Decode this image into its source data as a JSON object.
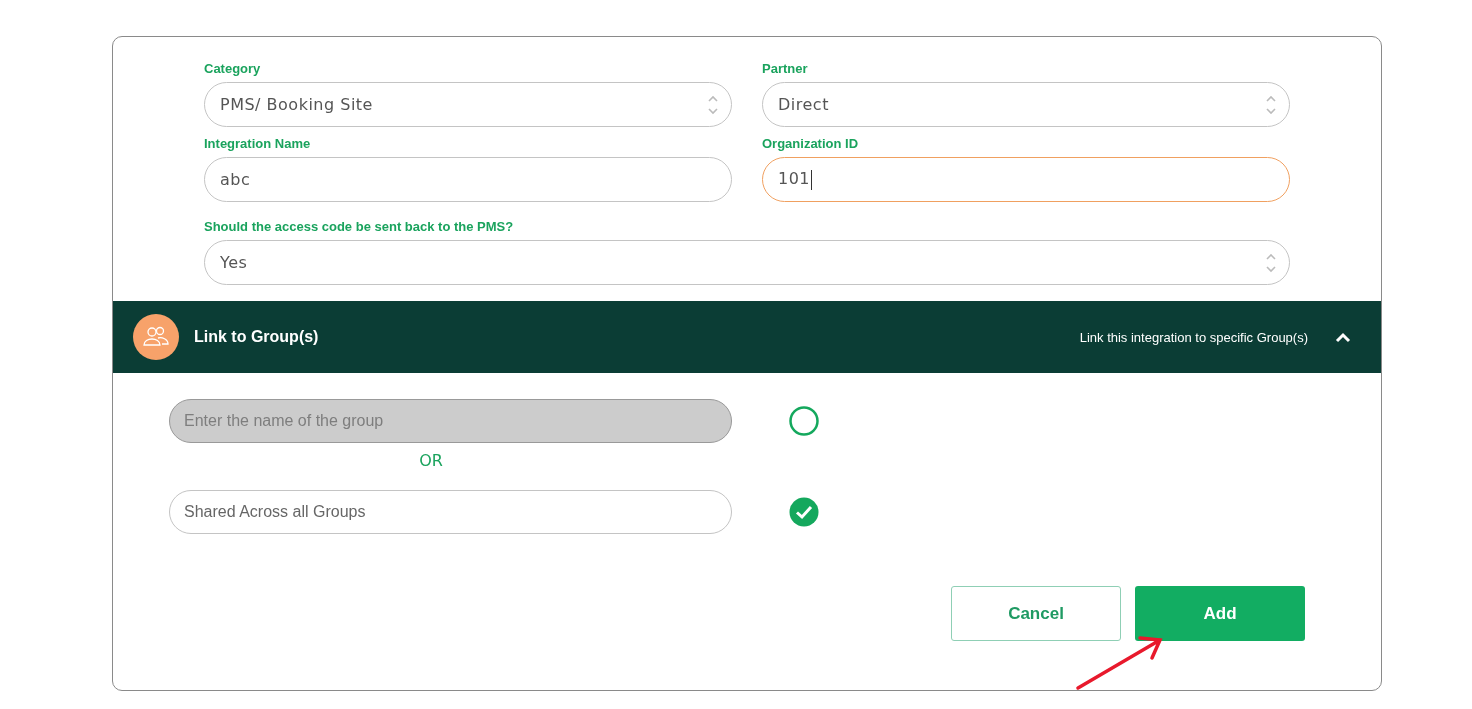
{
  "fields": [
    {
      "kind": "select",
      "label": "Category",
      "value": "PMS/ Booking Site",
      "focused": false,
      "wide": false
    },
    {
      "kind": "select",
      "label": "Partner",
      "value": "Direct",
      "focused": false,
      "wide": false
    },
    {
      "kind": "text",
      "label": "Integration Name",
      "value": "abc",
      "focused": false,
      "wide": false
    },
    {
      "kind": "text",
      "label": "Organization ID",
      "value": "101",
      "focused": true,
      "wide": false
    },
    {
      "kind": "select",
      "label": "Should the access code be sent back to the PMS?",
      "value": "Yes",
      "focused": false,
      "wide": true
    }
  ],
  "section": {
    "title": "Link to Group(s)",
    "subtitle": "Link this integration to specific Group(s)",
    "expanded": true
  },
  "group_options": [
    {
      "placeholder": "Enter the name of the group",
      "disabled": true,
      "selected": false
    },
    {
      "value": "Shared Across all Groups",
      "disabled": false,
      "selected": true
    }
  ],
  "separator": "OR",
  "buttons": [
    {
      "kind": "secondary",
      "label": "Cancel"
    },
    {
      "kind": "primary",
      "label": "Add"
    }
  ]
}
